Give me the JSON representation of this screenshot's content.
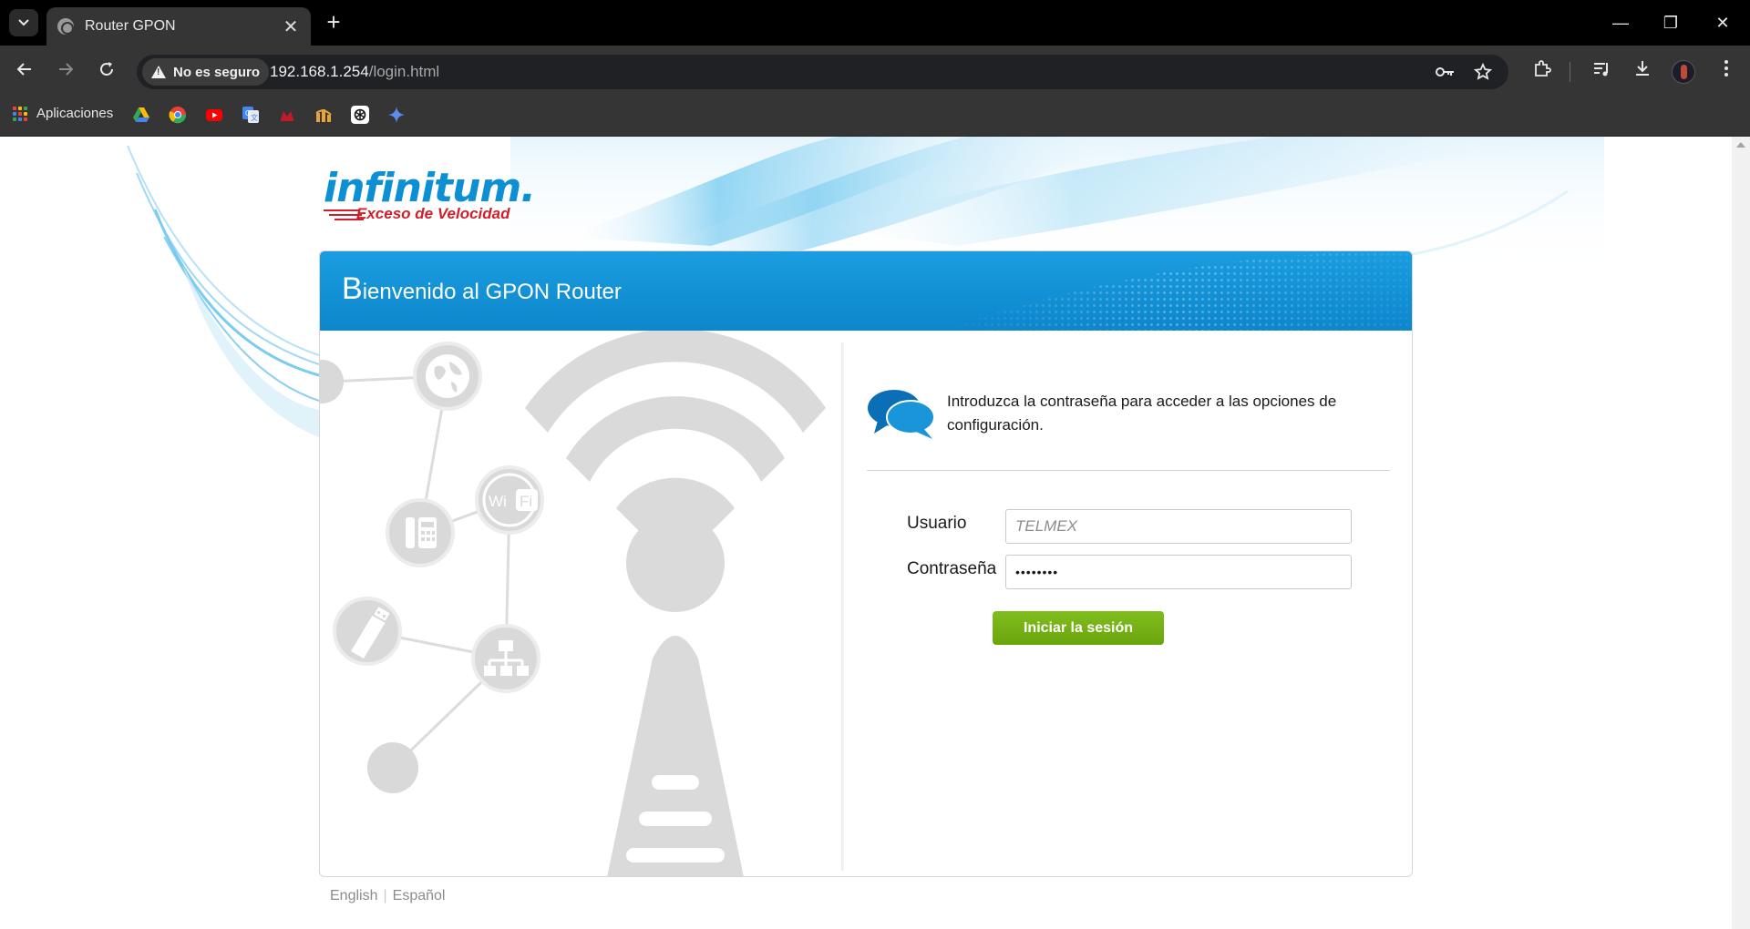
{
  "browser": {
    "tab_title": "Router GPON",
    "tab_close_glyph": "✕",
    "new_tab_glyph": "+",
    "window_controls": {
      "minimize": "—",
      "restore": "❐",
      "close": "✕"
    },
    "security_label": "No es seguro",
    "url_host": "192.168.1.254",
    "url_path": "/login.html",
    "bookmarks_apps_label": "Aplicaciones",
    "bookmark_icons": [
      "google-drive-icon",
      "chrome-web-store-icon",
      "youtube-icon",
      "google-translate-icon",
      "red-app-icon",
      "orange-bars-icon",
      "openai-icon",
      "gemini-sparkle-icon"
    ]
  },
  "page": {
    "logo_text": "infinitum.",
    "logo_tagline": "Exceso de Velocidad",
    "header_cap": "B",
    "header_rest": "ienvenido al GPON Router",
    "info_text": "Introduzca la contraseña para acceder a las opciones de configuración.",
    "username_label": "Usuario",
    "username_placeholder": "TELMEX",
    "password_label": "Contraseña",
    "password_value": "••••••••",
    "submit_label": "Iniciar la sesión",
    "lang_english": "English",
    "lang_spanish": "Español",
    "wifi_label_left": "Wi",
    "wifi_label_right": "Fi",
    "colors": {
      "brand_blue": "#0d86cc",
      "brand_red": "#d01f2a",
      "submit_green": "#6aa50d",
      "illustration_gray": "#d9d9d9"
    }
  }
}
